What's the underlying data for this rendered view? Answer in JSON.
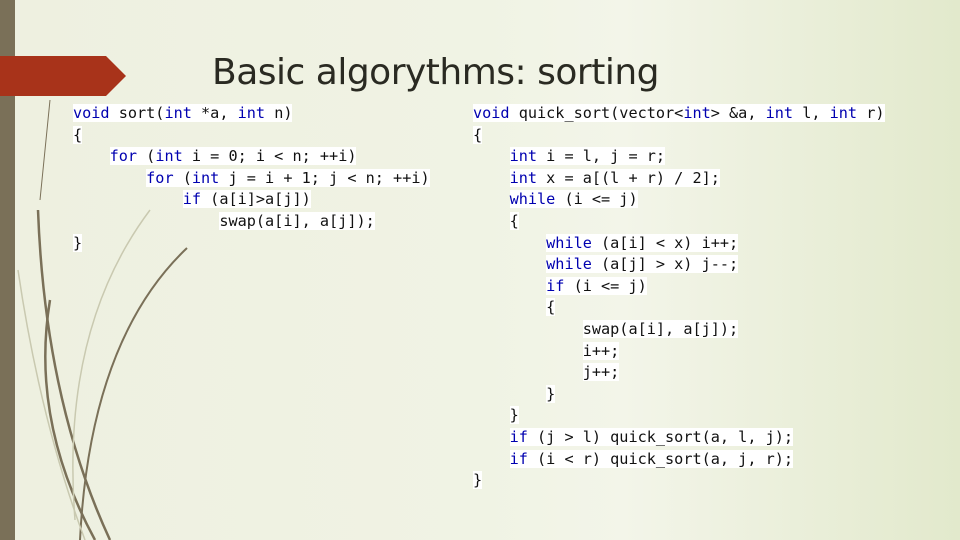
{
  "slide": {
    "title": "Basic algorythms: sorting",
    "colors": {
      "left_bar": "#7a7058",
      "arrow_tag": "#a8331a",
      "keyword": "#0000b0",
      "param": "#7f7f7f",
      "background": "#eef0e0"
    }
  },
  "left_code": {
    "lines": [
      "void sort(int *a, int n)",
      "{",
      "    for (int i = 0; i < n; ++i)",
      "        for (int j = i + 1; j < n; ++i)",
      "            if (a[i]>a[j])",
      "                swap(a[i], a[j]);",
      "}"
    ]
  },
  "right_code": {
    "lines": [
      "void quick_sort(vector<int> &a, int l, int r)",
      "{",
      "    int i = l, j = r;",
      "    int x = a[(l + r) / 2];",
      "    while (i <= j)",
      "    {",
      "        while (a[i] < x) i++;",
      "        while (a[j] > x) j--;",
      "        if (i <= j)",
      "        {",
      "            swap(a[i], a[j]);",
      "            i++;",
      "            j++;",
      "        }",
      "    }",
      "    if (j > l) quick_sort(a, l, j);",
      "    if (i < r) quick_sort(a, j, r);",
      "}"
    ]
  }
}
